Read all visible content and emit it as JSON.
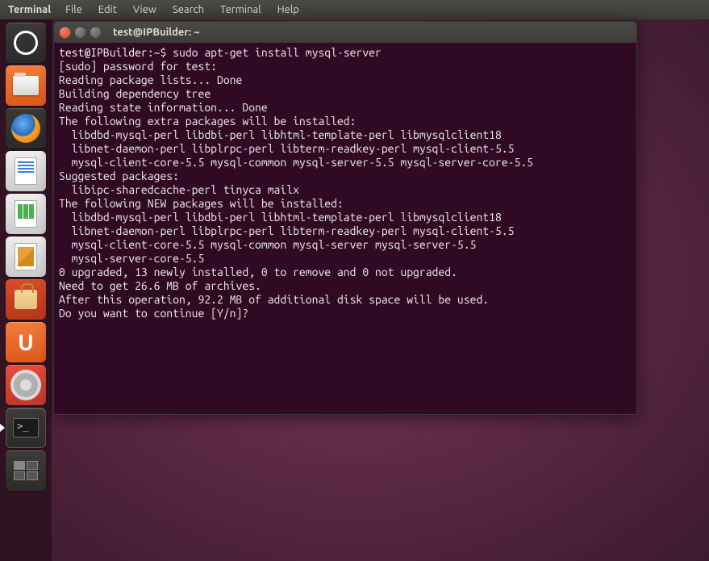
{
  "menubar": {
    "app": "Terminal",
    "items": [
      "File",
      "Edit",
      "View",
      "Search",
      "Terminal",
      "Help"
    ]
  },
  "launcher": {
    "items": [
      {
        "name": "dash",
        "tooltip": "Dash Home"
      },
      {
        "name": "files",
        "tooltip": "Files"
      },
      {
        "name": "firefox",
        "tooltip": "Firefox Web Browser"
      },
      {
        "name": "writer",
        "tooltip": "LibreOffice Writer"
      },
      {
        "name": "calc",
        "tooltip": "LibreOffice Calc"
      },
      {
        "name": "impress",
        "tooltip": "LibreOffice Impress"
      },
      {
        "name": "software",
        "tooltip": "Ubuntu Software Center"
      },
      {
        "name": "ubuntuone",
        "tooltip": "Ubuntu One"
      },
      {
        "name": "settings",
        "tooltip": "System Settings"
      },
      {
        "name": "terminal",
        "tooltip": "Terminal",
        "active": true
      },
      {
        "name": "workspace",
        "tooltip": "Workspace Switcher"
      }
    ]
  },
  "terminal": {
    "title": "test@IPBuilder: ~",
    "prompt_user": "test@IPBuilder",
    "prompt_path": "~",
    "prompt_suffix": "$",
    "command": "sudo apt-get install mysql-server",
    "lines": [
      "[sudo] password for test:",
      "Reading package lists... Done",
      "Building dependency tree",
      "Reading state information... Done",
      "The following extra packages will be installed:",
      "  libdbd-mysql-perl libdbi-perl libhtml-template-perl libmysqlclient18",
      "  libnet-daemon-perl libplrpc-perl libterm-readkey-perl mysql-client-5.5",
      "  mysql-client-core-5.5 mysql-common mysql-server-5.5 mysql-server-core-5.5",
      "Suggested packages:",
      "  libipc-sharedcache-perl tinyca mailx",
      "The following NEW packages will be installed:",
      "  libdbd-mysql-perl libdbi-perl libhtml-template-perl libmysqlclient18",
      "  libnet-daemon-perl libplrpc-perl libterm-readkey-perl mysql-client-5.5",
      "  mysql-client-core-5.5 mysql-common mysql-server mysql-server-5.5",
      "  mysql-server-core-5.5",
      "0 upgraded, 13 newly installed, 0 to remove and 0 not upgraded.",
      "Need to get 26.6 MB of archives.",
      "After this operation, 92.2 MB of additional disk space will be used.",
      "Do you want to continue [Y/n]?"
    ]
  }
}
